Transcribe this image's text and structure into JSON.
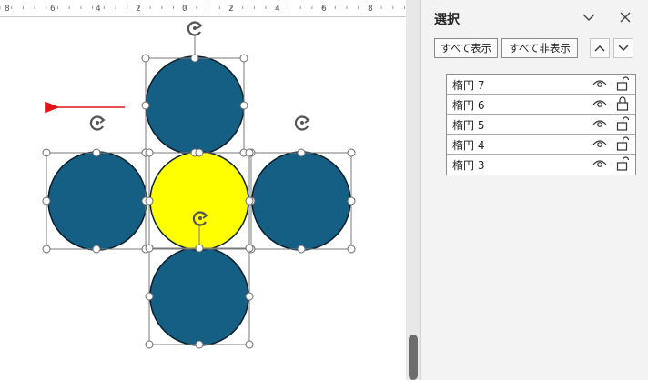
{
  "pane": {
    "title": "選択",
    "show_all": "すべて表示",
    "hide_all": "すべて非表示",
    "items": [
      {
        "label": "楕円 7",
        "locked": false
      },
      {
        "label": "楕円 6",
        "locked": true
      },
      {
        "label": "楕円 5",
        "locked": false
      },
      {
        "label": "楕円 4",
        "locked": false
      },
      {
        "label": "楕円 3",
        "locked": false
      }
    ]
  },
  "ruler": {
    "numbers": [
      "8",
      "6",
      "4",
      "2",
      "0",
      "2",
      "4",
      "6",
      "8"
    ]
  },
  "colors": {
    "circle_blue": "#155e84",
    "circle_yellow": "#ffff00",
    "arrow_red": "#e01515"
  },
  "icons": [
    "rotate-handle-icon",
    "chevron-down-icon",
    "close-icon",
    "chevron-up-icon",
    "eye-icon",
    "lock-icon",
    "unlock-icon"
  ]
}
